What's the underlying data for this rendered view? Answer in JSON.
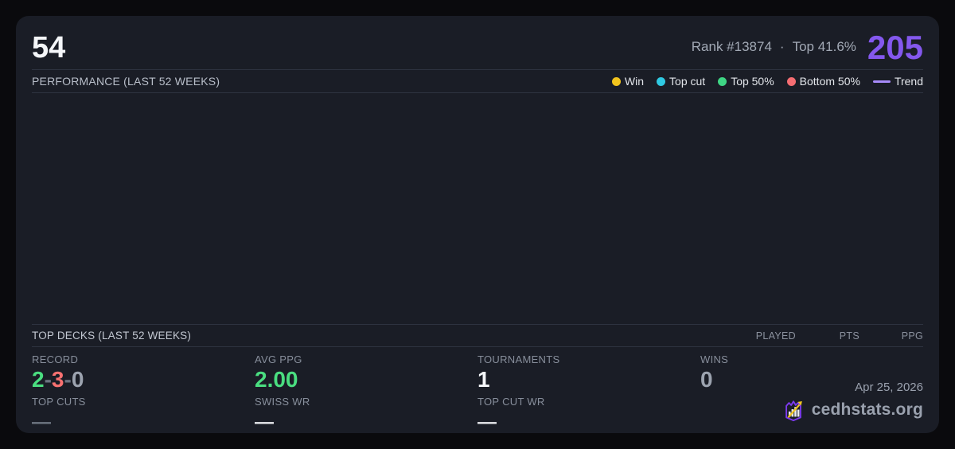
{
  "header": {
    "score": "54",
    "rank": "Rank #13874",
    "separator": "·",
    "percentile": "Top 41.6%",
    "points": "205",
    "points_color": "#8458ee"
  },
  "performance": {
    "title": "PERFORMANCE (LAST 52 WEEKS)",
    "legend": [
      {
        "label": "Win",
        "marker": "dot",
        "color": "#f2c41d"
      },
      {
        "label": "Top cut",
        "marker": "dot",
        "color": "#2fc9e2"
      },
      {
        "label": "Top 50%",
        "marker": "dot",
        "color": "#3ed584"
      },
      {
        "label": "Bottom 50%",
        "marker": "dot",
        "color": "#f56d72"
      },
      {
        "label": "Trend",
        "marker": "line",
        "color": "#a78bfa"
      }
    ],
    "chart_empty": true
  },
  "top_decks": {
    "title": "TOP DECKS (LAST 52 WEEKS)",
    "columns": [
      "PLAYED",
      "PTS",
      "PPG"
    ],
    "rows": []
  },
  "stats": {
    "columns": [
      {
        "label": "RECORD",
        "value_parts": [
          {
            "text": "2",
            "color": "#4ade80"
          },
          {
            "text": "-",
            "color": "#6b7280"
          },
          {
            "text": "3",
            "color": "#f87171"
          },
          {
            "text": "-",
            "color": "#6b7280"
          },
          {
            "text": "0",
            "color": "#9ca3af"
          }
        ],
        "label2": "TOP CUTS",
        "value2": "—",
        "value2_color": "#6f7682"
      },
      {
        "label": "AVG PPG",
        "value": "2.00",
        "value_color": "#4ade80",
        "label2": "SWISS WR",
        "value2": "—",
        "value2_color": "#e8eaee"
      },
      {
        "label": "TOURNAMENTS",
        "value": "1",
        "value_color": "#f4f6f9",
        "label2": "TOP CUT WR",
        "value2": "—",
        "value2_color": "#e8eaee"
      },
      {
        "label": "WINS",
        "value": "0",
        "value_color": "#9ca3af"
      }
    ]
  },
  "footer": {
    "date": "Apr 25, 2026",
    "brand": "cedhstats.org"
  }
}
